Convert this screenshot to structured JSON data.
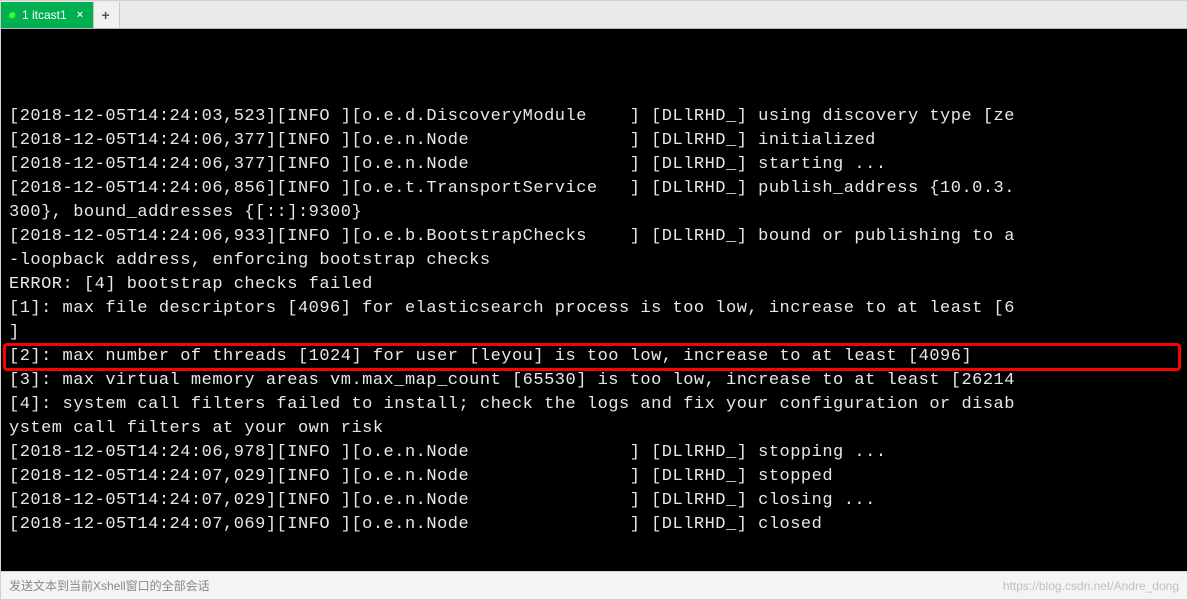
{
  "tabs": {
    "active_label": "1 itcast1",
    "close_glyph": "×",
    "new_glyph": "+"
  },
  "terminal": {
    "lines": [
      "[2018-12-05T14:24:03,523][INFO ][o.e.d.DiscoveryModule    ] [DLlRHD_] using discovery type [ze",
      "[2018-12-05T14:24:06,377][INFO ][o.e.n.Node               ] [DLlRHD_] initialized",
      "[2018-12-05T14:24:06,377][INFO ][o.e.n.Node               ] [DLlRHD_] starting ...",
      "[2018-12-05T14:24:06,856][INFO ][o.e.t.TransportService   ] [DLlRHD_] publish_address {10.0.3.",
      "300}, bound_addresses {[::]:9300}",
      "[2018-12-05T14:24:06,933][INFO ][o.e.b.BootstrapChecks    ] [DLlRHD_] bound or publishing to a",
      "-loopback address, enforcing bootstrap checks",
      "ERROR: [4] bootstrap checks failed",
      "[1]: max file descriptors [4096] for elasticsearch process is too low, increase to at least [6",
      "]",
      "[2]: max number of threads [1024] for user [leyou] is too low, increase to at least [4096]",
      "[3]: max virtual memory areas vm.max_map_count [65530] is too low, increase to at least [26214",
      "[4]: system call filters failed to install; check the logs and fix your configuration or disab",
      "ystem call filters at your own risk",
      "[2018-12-05T14:24:06,978][INFO ][o.e.n.Node               ] [DLlRHD_] stopping ...",
      "[2018-12-05T14:24:07,029][INFO ][o.e.n.Node               ] [DLlRHD_] stopped",
      "[2018-12-05T14:24:07,029][INFO ][o.e.n.Node               ] [DLlRHD_] closing ...",
      "[2018-12-05T14:24:07,069][INFO ][o.e.n.Node               ] [DLlRHD_] closed"
    ],
    "highlight_line_index": 10,
    "cursor_glyph": "I"
  },
  "statusbar": {
    "hint": "发送文本到当前Xshell窗口的全部会话",
    "watermark": "https://blog.csdn.net/Andre_dong"
  },
  "colors": {
    "tab_active_bg": "#00b050",
    "terminal_bg": "#000000",
    "terminal_fg": "#e8e8e8",
    "highlight_border": "#ff0000"
  }
}
